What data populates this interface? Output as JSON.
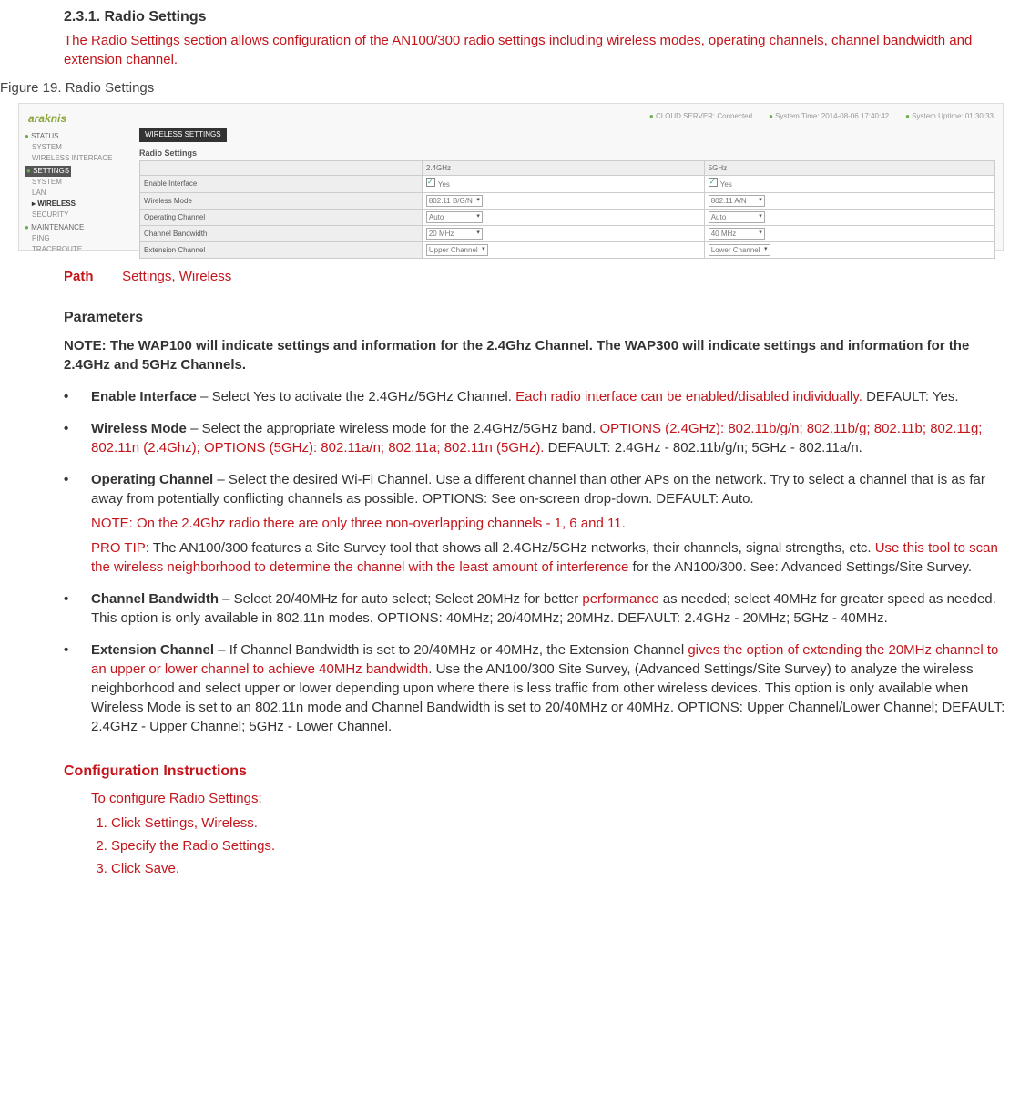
{
  "section": {
    "number_title": "2.3.1. Radio Settings",
    "desc": "The Radio Settings section allows configuration of the AN100/300 radio settings including wireless modes, operating channels, channel bandwidth and extension channel."
  },
  "figure_label": "Figure 19. Radio Settings",
  "screenshot": {
    "logo": "araknis",
    "cloud": "CLOUD SERVER:  Connected",
    "systime": "System Time:  2014-08-06 17:40:42",
    "uptime": "System Uptime:  01:30:33",
    "nav": {
      "status": "STATUS",
      "system1": "SYSTEM",
      "wiface": "WIRELESS INTERFACE",
      "settings": "SETTINGS",
      "system2": "SYSTEM",
      "lan": "LAN",
      "wireless": "▸ WIRELESS",
      "security": "SECURITY",
      "maint": "MAINTENANCE",
      "ping": "PING",
      "trace": "TRACEROUTE"
    },
    "bar": "WIRELESS SETTINGS",
    "title": "Radio Settings",
    "cols": {
      "c1": "2.4GHz",
      "c2": "5GHz"
    },
    "rows": {
      "r1": {
        "label": "Enable Interface",
        "v1": "Yes",
        "v2": "Yes"
      },
      "r2": {
        "label": "Wireless Mode",
        "v1": "802.11 B/G/N",
        "v2": "802.11 A/N"
      },
      "r3": {
        "label": "Operating Channel",
        "v1": "Auto",
        "v2": "Auto"
      },
      "r4": {
        "label": "Channel Bandwidth",
        "v1": "20 MHz",
        "v2": "40 MHz"
      },
      "r5": {
        "label": "Extension Channel",
        "v1": "Upper Channel",
        "v2": "Lower Channel"
      }
    }
  },
  "path": {
    "label": "Path",
    "value": "Settings, Wireless"
  },
  "parameters_heading": "Parameters",
  "note_text": "NOTE: The WAP100 will indicate settings and information for the 2.4Ghz Channel. The WAP300 will indicate settings and information for the 2.4GHz and 5GHz Channels.",
  "params": {
    "enable": {
      "name": "Enable Interface",
      "t1": " – Select Yes to activate the 2.4GHz/5GHz Channel. ",
      "r1": "Each radio interface can be enabled/disabled individually.",
      "t2": " DEFAULT: Yes."
    },
    "wmode": {
      "name": "Wireless Mode",
      "t1": " – Select the appropriate wireless mode for the 2.4GHz/5GHz band. ",
      "r1": "OPTIONS (2.4GHz): 802.11b/g/n; 802.11b/g; 802.11b; 802.11g; 802.11n (2.4Ghz); OPTIONS (5GHz): 802.11a/n; 802.11a; 802.11n (5GHz).",
      "t2": " DEFAULT: 2.4GHz - 802.11b/g/n; 5GHz - 802.11a/n."
    },
    "opch": {
      "name": "Operating Channel",
      "t1": " – Select the desired Wi-Fi Channel. Use a different channel than other APs on the network. Try to select a channel that is as far away from potentially conflicting channels as possible. OPTIONS: See on-screen drop-down. DEFAULT: Auto.",
      "note": "NOTE: On the 2.4Ghz radio there are only three non-overlapping channels - 1, 6 and 11.",
      "pro_label": "PRO TIP:",
      "pro_t1": " The AN100/300 features a Site Survey tool that shows all 2.4GHz/5GHz networks, their channels, signal strengths, etc. ",
      "pro_r1": "Use this tool to scan the wireless neighborhood to determine the channel with the least amount of interference",
      "pro_t2": " for the AN100/300. See: Advanced Settings/Site Survey."
    },
    "chbw": {
      "name": "Channel Bandwidth",
      "t1": " – Select 20/40MHz for auto select; Select 20MHz for better ",
      "r1": "performance",
      "t2": " as needed; select 40MHz for greater speed as needed. This option is only available in 802.11n modes. OPTIONS: 40MHz; 20/40MHz; 20MHz. DEFAULT: 2.4GHz - 20MHz; 5GHz - 40MHz."
    },
    "ext": {
      "name": "Extension Channel",
      "t1": " – If Channel Bandwidth is set to 20/40MHz or 40MHz, the Extension Channel ",
      "r1": "gives the option of extending the 20MHz channel to an upper or lower channel to achieve 40MHz bandwidth",
      "t2": ". Use the AN100/300 Site Survey, (Advanced Settings/Site Survey) to analyze the wireless neighborhood and select upper or lower depending upon where there is less traffic from other wireless devices. This option is only available when Wireless Mode is set to an 802.11n mode and Channel Bandwidth is set to 20/40MHz or 40MHz. OPTIONS: Upper Channel/Lower Channel; DEFAULT: 2.4GHz - Upper Channel; 5GHz - Lower Channel."
    }
  },
  "config": {
    "heading": "Configuration Instructions",
    "intro": "To configure Radio Settings:",
    "s1": "Click Settings, Wireless.",
    "s2": "Specify the Radio Settings.",
    "s3": "Click Save."
  }
}
